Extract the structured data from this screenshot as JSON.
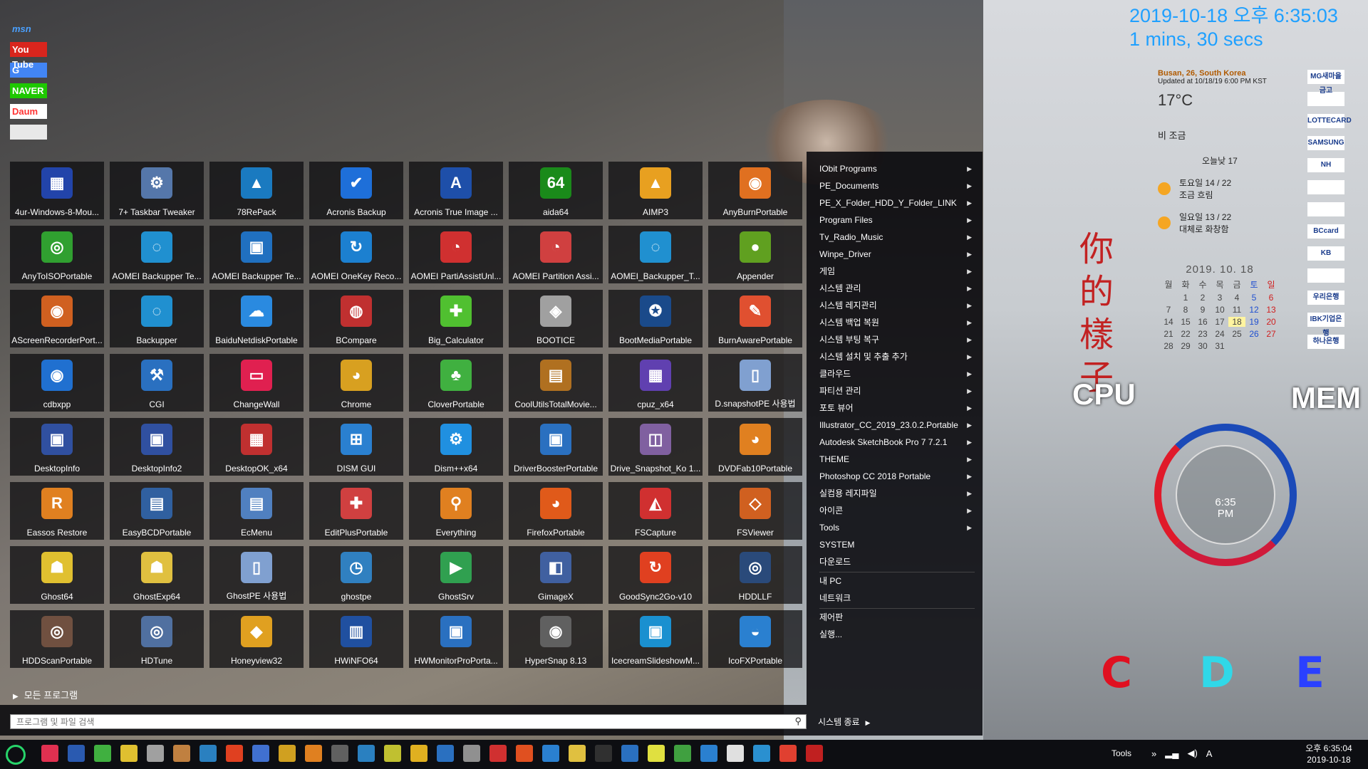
{
  "site_links": [
    "msn",
    "You Tube",
    "G",
    "NAVER",
    "Daum",
    ""
  ],
  "clock": {
    "line1": "2019-10-18 오후 6:35:03",
    "line2": "1 mins, 30 secs"
  },
  "weather": {
    "city": "Busan, 26, South Korea",
    "updated": "Updated at 10/18/19 6:00 PM KST",
    "temp": "17°C",
    "desc": "비 조금",
    "today": "오늘낮 17",
    "forecast": [
      {
        "day": "토요일 14 / 22",
        "cond": "조금 흐림"
      },
      {
        "day": "일요일 13 / 22",
        "cond": "대체로 화창함"
      }
    ]
  },
  "calendar": {
    "title": "2019. 10. 18",
    "weekdays": [
      "월",
      "화",
      "수",
      "목",
      "금",
      "토",
      "일"
    ],
    "days": [
      "",
      "1",
      "2",
      "3",
      "4",
      "5",
      "6",
      "7",
      "8",
      "9",
      "10",
      "11",
      "12",
      "13",
      "14",
      "15",
      "16",
      "17",
      "18",
      "19",
      "20",
      "21",
      "22",
      "23",
      "24",
      "25",
      "26",
      "27",
      "28",
      "29",
      "30",
      "31",
      "",
      "",
      ""
    ]
  },
  "banks": [
    "MG새마을금고",
    "",
    "LOTTECARD",
    "SAMSUNG",
    "NH",
    "",
    "",
    "BCcard",
    "KB",
    "",
    "우리은행",
    "IBK기업은행",
    "하나은행"
  ],
  "gauge": {
    "cpu": "CPU",
    "mem": "MEM",
    "time": "6:35",
    "ampm": "PM"
  },
  "drives": [
    "C",
    "D",
    "E"
  ],
  "calligraphy": "你的 樣子",
  "tiles": [
    {
      "label": "4ur-Windows-8-Mou...",
      "color": "#2244aa",
      "glyph": "▦"
    },
    {
      "label": "7+ Taskbar Tweaker",
      "color": "#5577aa",
      "glyph": "⚙"
    },
    {
      "label": "78RePack",
      "color": "#1a7ac0",
      "glyph": "▲"
    },
    {
      "label": "Acronis Backup",
      "color": "#1e6fd9",
      "glyph": "✔"
    },
    {
      "label": "Acronis True Image ...",
      "color": "#1e4fa9",
      "glyph": "A"
    },
    {
      "label": "aida64",
      "color": "#1a8a1a",
      "glyph": "64"
    },
    {
      "label": "AIMP3",
      "color": "#e8a020",
      "glyph": "▲"
    },
    {
      "label": "AnyBurnPortable",
      "color": "#e07020",
      "glyph": "◉"
    },
    {
      "label": "AnyToISOPortable",
      "color": "#30a030",
      "glyph": "◎"
    },
    {
      "label": "AOMEI Backupper Te...",
      "color": "#2090d0",
      "glyph": "◌"
    },
    {
      "label": "AOMEI Backupper Te...",
      "color": "#2070c0",
      "glyph": "▣"
    },
    {
      "label": "AOMEI OneKey Reco...",
      "color": "#1c80d0",
      "glyph": "↻"
    },
    {
      "label": "AOMEI PartiAssistUnl...",
      "color": "#d03030",
      "glyph": "◔"
    },
    {
      "label": "AOMEI Partition Assi...",
      "color": "#d04040",
      "glyph": "◔"
    },
    {
      "label": "AOMEI_Backupper_T...",
      "color": "#2090d0",
      "glyph": "◌"
    },
    {
      "label": "Appender",
      "color": "#60a020",
      "glyph": "●"
    },
    {
      "label": "AScreenRecorderPort...",
      "color": "#d06020",
      "glyph": "◉"
    },
    {
      "label": "Backupper",
      "color": "#2090d0",
      "glyph": "◌"
    },
    {
      "label": "BaiduNetdiskPortable",
      "color": "#2a8ae0",
      "glyph": "☁"
    },
    {
      "label": "BCompare",
      "color": "#c03030",
      "glyph": "◍"
    },
    {
      "label": "Big_Calculator",
      "color": "#50c030",
      "glyph": "✚"
    },
    {
      "label": "BOOTICE",
      "color": "#a0a0a0",
      "glyph": "◈"
    },
    {
      "label": "BootMediaPortable",
      "color": "#1a4a8a",
      "glyph": "✪"
    },
    {
      "label": "BurnAwarePortable",
      "color": "#e05030",
      "glyph": "✎"
    },
    {
      "label": "cdbxpp",
      "color": "#2070d0",
      "glyph": "◉"
    },
    {
      "label": "CGI",
      "color": "#2a70c0",
      "glyph": "⚒"
    },
    {
      "label": "ChangeWall",
      "color": "#e02050",
      "glyph": "▭"
    },
    {
      "label": "Chrome",
      "color": "#d8a020",
      "glyph": "◕"
    },
    {
      "label": "CloverPortable",
      "color": "#40b040",
      "glyph": "♣"
    },
    {
      "label": "CoolUtilsTotalMovie...",
      "color": "#b07020",
      "glyph": "▤"
    },
    {
      "label": "cpuz_x64",
      "color": "#6040b0",
      "glyph": "▦"
    },
    {
      "label": "D.snapshotPE 사용법",
      "color": "#80a0d0",
      "glyph": "▯"
    },
    {
      "label": "DesktopInfo",
      "color": "#3050a0",
      "glyph": "▣"
    },
    {
      "label": "DesktopInfo2",
      "color": "#3050a0",
      "glyph": "▣"
    },
    {
      "label": "DesktopOK_x64",
      "color": "#c03030",
      "glyph": "▦"
    },
    {
      "label": "DISM GUI",
      "color": "#2a80d0",
      "glyph": "⊞"
    },
    {
      "label": "Dism++x64",
      "color": "#2090e0",
      "glyph": "⚙"
    },
    {
      "label": "DriverBoosterPortable",
      "color": "#2a70c0",
      "glyph": "▣"
    },
    {
      "label": "Drive_Snapshot_Ko 1...",
      "color": "#8060a0",
      "glyph": "◫"
    },
    {
      "label": "DVDFab10Portable",
      "color": "#e08020",
      "glyph": "◕"
    },
    {
      "label": "Eassos Restore",
      "color": "#e08020",
      "glyph": "R"
    },
    {
      "label": "EasyBCDPortable",
      "color": "#3060a0",
      "glyph": "▤"
    },
    {
      "label": "EcMenu",
      "color": "#5080c0",
      "glyph": "▤"
    },
    {
      "label": "EditPlusPortable",
      "color": "#d04040",
      "glyph": "✚"
    },
    {
      "label": "Everything",
      "color": "#e08020",
      "glyph": "⚲"
    },
    {
      "label": "FirefoxPortable",
      "color": "#e05a1a",
      "glyph": "◕"
    },
    {
      "label": "FSCapture",
      "color": "#d03030",
      "glyph": "◭"
    },
    {
      "label": "FSViewer",
      "color": "#d06020",
      "glyph": "◇"
    },
    {
      "label": "Ghost64",
      "color": "#e0c030",
      "glyph": "☗"
    },
    {
      "label": "GhostExp64",
      "color": "#e0c040",
      "glyph": "☗"
    },
    {
      "label": "GhostPE 사용법",
      "color": "#80a0d0",
      "glyph": "▯"
    },
    {
      "label": "ghostpe",
      "color": "#3080c0",
      "glyph": "◷"
    },
    {
      "label": "GhostSrv",
      "color": "#30a050",
      "glyph": "▶"
    },
    {
      "label": "GimageX",
      "color": "#4060a0",
      "glyph": "◧"
    },
    {
      "label": "GoodSync2Go-v10",
      "color": "#e04020",
      "glyph": "↻"
    },
    {
      "label": "HDDLLF",
      "color": "#2a4a7a",
      "glyph": "◎"
    },
    {
      "label": "HDDScanPortable",
      "color": "#705040",
      "glyph": "◎"
    },
    {
      "label": "HDTune",
      "color": "#5070a0",
      "glyph": "◎"
    },
    {
      "label": "Honeyview32",
      "color": "#e0a020",
      "glyph": "◆"
    },
    {
      "label": "HWiNFO64",
      "color": "#2050a0",
      "glyph": "▥"
    },
    {
      "label": "HWMonitorProPorta...",
      "color": "#2a70c0",
      "glyph": "▣"
    },
    {
      "label": "HyperSnap 8.13",
      "color": "#606060",
      "glyph": "◉"
    },
    {
      "label": "IcecreamSlideshowM...",
      "color": "#1a90d0",
      "glyph": "▣"
    },
    {
      "label": "IcoFXPortable",
      "color": "#2a80d0",
      "glyph": "◒"
    }
  ],
  "menu": [
    {
      "label": "IObit Programs",
      "arrow": true
    },
    {
      "label": "PE_Documents",
      "arrow": true
    },
    {
      "label": "PE_X_Folder_HDD_Y_Folder_LINK",
      "arrow": true
    },
    {
      "label": "Program Files",
      "arrow": true
    },
    {
      "label": "Tv_Radio_Music",
      "arrow": true
    },
    {
      "label": "Winpe_Driver",
      "arrow": true
    },
    {
      "label": "게임",
      "arrow": true
    },
    {
      "label": "시스템 관리",
      "arrow": true
    },
    {
      "label": "시스템 레지관리",
      "arrow": true
    },
    {
      "label": "시스템 백업 복원",
      "arrow": true
    },
    {
      "label": "시스템 부팅 복구",
      "arrow": true
    },
    {
      "label": "시스템 설치 및 추출 추가",
      "arrow": true
    },
    {
      "label": "클라우드",
      "arrow": true
    },
    {
      "label": "파티션 관리",
      "arrow": true
    },
    {
      "label": "포토 뷰어",
      "arrow": true
    },
    {
      "label": "Illustrator_CC_2019_23.0.2.Portable",
      "arrow": true
    },
    {
      "label": "Autodesk SketchBook Pro 7 7.2.1",
      "arrow": true
    },
    {
      "label": "THEME",
      "arrow": true
    },
    {
      "label": "Photoshop CC 2018 Portable",
      "arrow": true
    },
    {
      "label": "실컴용 레지파일",
      "arrow": true
    },
    {
      "label": "아이콘",
      "arrow": true
    },
    {
      "label": "Tools",
      "arrow": true
    },
    {
      "label": "SYSTEM",
      "arrow": false
    },
    {
      "label": "다운로드",
      "arrow": false
    },
    {
      "label": "내 PC",
      "arrow": false,
      "sep": true
    },
    {
      "label": "네트워크",
      "arrow": false
    },
    {
      "label": "제어판",
      "arrow": false,
      "sep": true
    },
    {
      "label": "실행...",
      "arrow": false
    }
  ],
  "all_programs": "모든 프로그램",
  "search_placeholder": "프로그램 및 파일 검색",
  "shutdown": "시스템 종료",
  "taskbar_colors": [
    "#e03050",
    "#2a5ab0",
    "#40b040",
    "#e0c030",
    "#a0a0a0",
    "#c08040",
    "#2a80c0",
    "#e04020",
    "#4070d0",
    "#d0a020",
    "#e08020",
    "#606060",
    "#2a80c0",
    "#c0c030",
    "#e0b020",
    "#2a70c0",
    "#909090",
    "#d03030",
    "#e05020",
    "#2a80d0",
    "#e0c040",
    "#303030",
    "#2a70c0",
    "#e0e040",
    "#40a040",
    "#2a80d0",
    "#e0e0e0",
    "#2a90d0",
    "#e04030",
    "#c02020"
  ],
  "tray": {
    "tools": "Tools",
    "ime": "A"
  },
  "taskbar_clock": {
    "time": "오후 6:35:04",
    "date": "2019-10-18"
  }
}
